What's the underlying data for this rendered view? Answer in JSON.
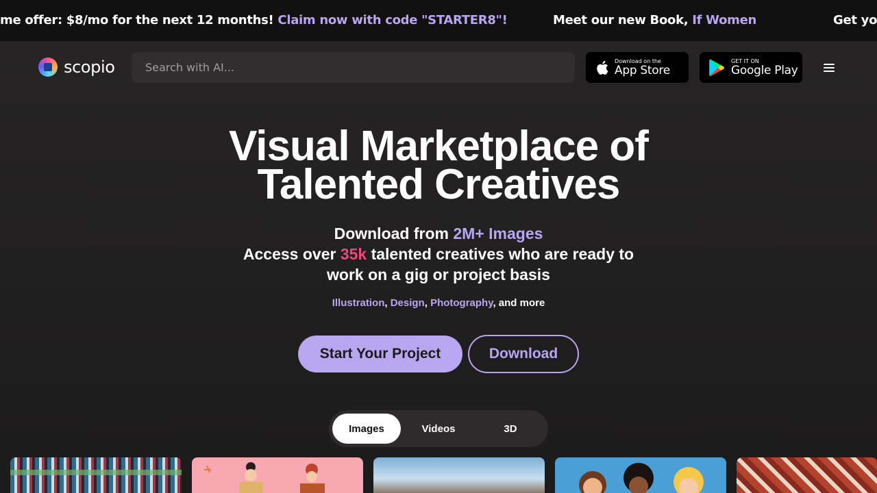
{
  "ticker": {
    "segments": [
      {
        "text": "me offer: $8/mo for the next 12 months! ",
        "highlight": "Claim now with code \"STARTER8\"!"
      },
      {
        "text": "Meet our new Book, ",
        "highlight": "If Women"
      },
      {
        "text": "Get you",
        "highlight": ""
      }
    ]
  },
  "nav": {
    "logo_text": "scopio",
    "search_placeholder": "Search with AI...",
    "app_store": {
      "small": "Download on the",
      "big": "App Store"
    },
    "google_play": {
      "small": "GET IT ON",
      "big": "Google Play"
    }
  },
  "hero": {
    "headline_line1": "Visual Marketplace of",
    "headline_line2": "Talented Creatives",
    "sub_line1_prefix": "Download from ",
    "sub_line1_highlight": "2M+ Images",
    "sub_line2_prefix": "Access over ",
    "sub_line2_highlight": "35k",
    "sub_line2_suffix": " talented creatives who are ready to",
    "sub_line3": "work on a gig or project basis",
    "categories": [
      "Illustration",
      "Design",
      "Photography"
    ],
    "categories_suffix": ", and more",
    "primary_button": "Start Your Project",
    "secondary_button": "Download"
  },
  "tabs": [
    {
      "label": "Images",
      "active": true
    },
    {
      "label": "Videos",
      "active": false
    },
    {
      "label": "3D",
      "active": false
    }
  ],
  "colors": {
    "accent_purple": "#b9a6f0",
    "accent_pink": "#f0477f",
    "background": "#1b1a1a"
  }
}
